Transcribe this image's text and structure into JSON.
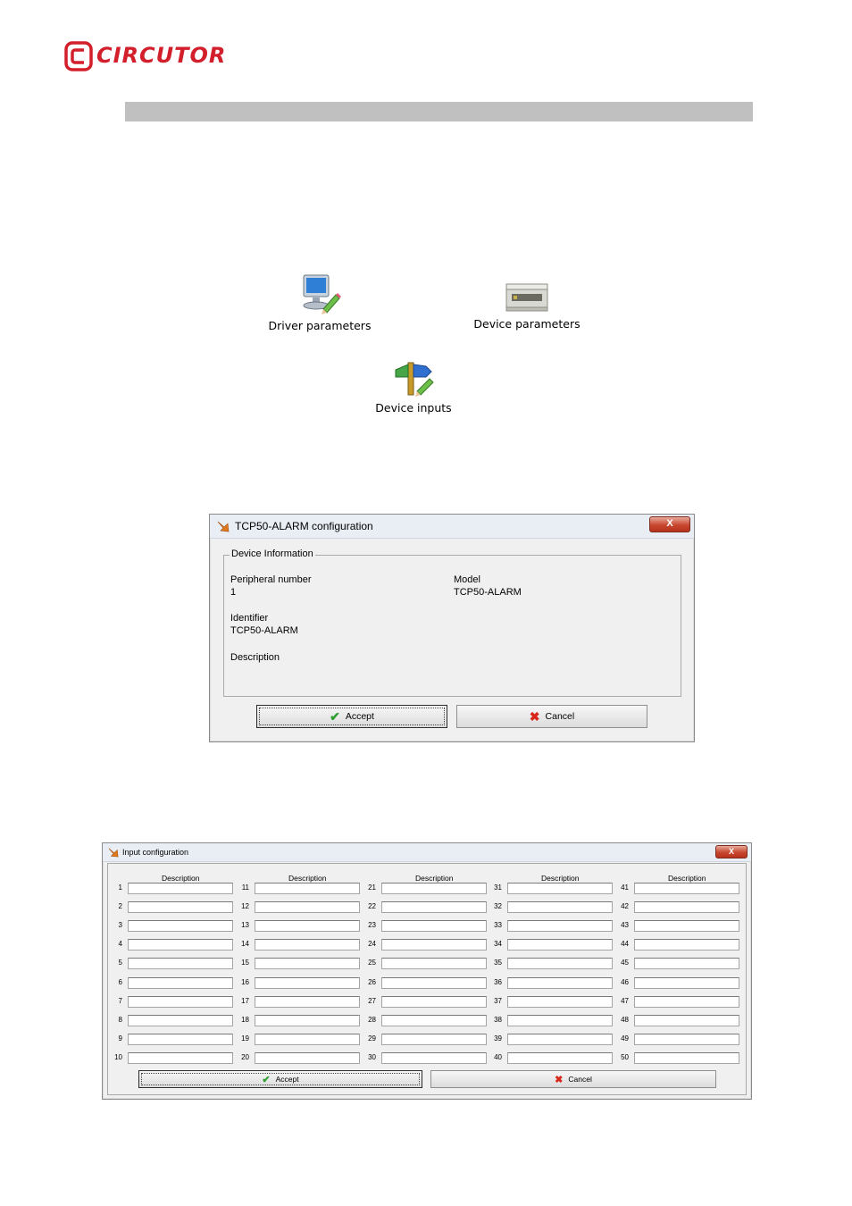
{
  "logo": {
    "text": "CIRCUTOR",
    "brand_color": "#d21f2b"
  },
  "launchers": [
    {
      "label": "Driver parameters",
      "icon": "monitor-pencil-icon"
    },
    {
      "label": "Device parameters",
      "icon": "din-rail-device-icon"
    },
    {
      "label": "Device inputs",
      "icon": "signpost-pencil-icon"
    }
  ],
  "config_dialog": {
    "title": "TCP50-ALARM configuration",
    "close_label": "X",
    "group_label": "Device Information",
    "peripheral_label": "Peripheral number",
    "peripheral_value": "1",
    "model_label": "Model",
    "model_value": "TCP50-ALARM",
    "identifier_label": "Identifier",
    "identifier_value": "TCP50-ALARM",
    "description_label": "Description",
    "accept_label": "Accept",
    "cancel_label": "Cancel"
  },
  "input_dialog": {
    "title": "Input configuration",
    "close_label": "X",
    "column_header": "Description",
    "columns": [
      [
        "1",
        "2",
        "3",
        "4",
        "5",
        "6",
        "7",
        "8",
        "9",
        "10"
      ],
      [
        "11",
        "12",
        "13",
        "14",
        "15",
        "16",
        "17",
        "18",
        "19",
        "20"
      ],
      [
        "21",
        "22",
        "23",
        "24",
        "25",
        "26",
        "27",
        "28",
        "29",
        "30"
      ],
      [
        "31",
        "32",
        "33",
        "34",
        "35",
        "36",
        "37",
        "38",
        "39",
        "40"
      ],
      [
        "41",
        "42",
        "43",
        "44",
        "45",
        "46",
        "47",
        "48",
        "49",
        "50"
      ]
    ],
    "accept_label": "Accept",
    "cancel_label": "Cancel"
  }
}
